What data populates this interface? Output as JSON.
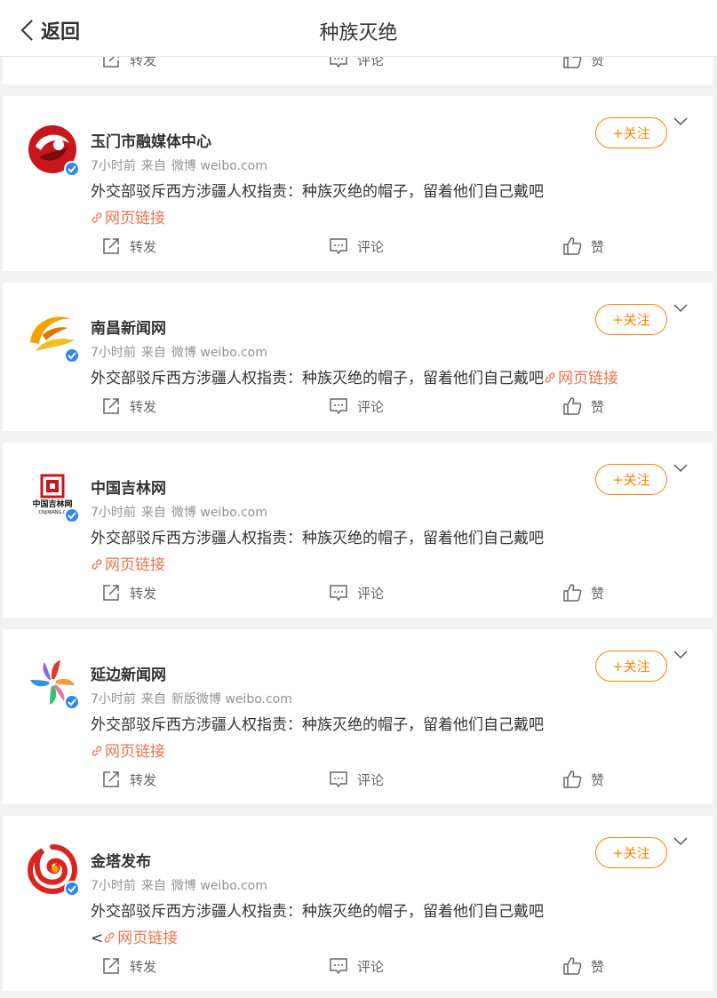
{
  "header": {
    "back_label": "返回",
    "title": "种族灭绝"
  },
  "actions": {
    "repost": "转发",
    "comment": "评论",
    "like": "赞"
  },
  "follow_label": "+关注",
  "posts": [
    {
      "name": "玉门市融媒体中心",
      "time": "7小时前",
      "from": "来自",
      "source": "微博 weibo.com",
      "text": "外交部驳斥西方涉疆人权指责：种族灭绝的帽子，留着他们自己戴吧",
      "link": "网页链接",
      "link_prefix": "",
      "avatar": "yumen-logo"
    },
    {
      "name": "南昌新闻网",
      "time": "7小时前",
      "from": "来自",
      "source": "微博 weibo.com",
      "text": "外交部驳斥西方涉疆人权指责：种族灭绝的帽子，留着他们自己戴吧",
      "link": "网页链接",
      "link_prefix": "",
      "avatar": "nanchang-logo"
    },
    {
      "name": "中国吉林网",
      "time": "7小时前",
      "from": "来自",
      "source": "微博 weibo.com",
      "text": "外交部驳斥西方涉疆人权指责：种族灭绝的帽子，留着他们自己戴吧",
      "link": "网页链接",
      "link_prefix": "",
      "avatar": "jilin-logo",
      "avatar_text": "中国吉林网",
      "avatar_subtext": "CNJIWANG.C"
    },
    {
      "name": "延边新闻网",
      "time": "7小时前",
      "from": "来自",
      "source": "新版微博 weibo.com",
      "text": "外交部驳斥西方涉疆人权指责：种族灭绝的帽子，留着他们自己戴吧",
      "link": "网页链接",
      "link_prefix": "",
      "avatar": "yanbian-logo"
    },
    {
      "name": "金塔发布",
      "time": "7小时前",
      "from": "来自",
      "source": "微博 weibo.com",
      "text": "外交部驳斥西方涉疆人权指责：种族灭绝的帽子，留着他们自己戴吧",
      "link": "网页链接",
      "link_prefix": "<",
      "avatar": "jinta-logo"
    }
  ],
  "colors": {
    "accent": "#ff8200",
    "link": "#eb7350",
    "verified": "#2f86f6"
  }
}
